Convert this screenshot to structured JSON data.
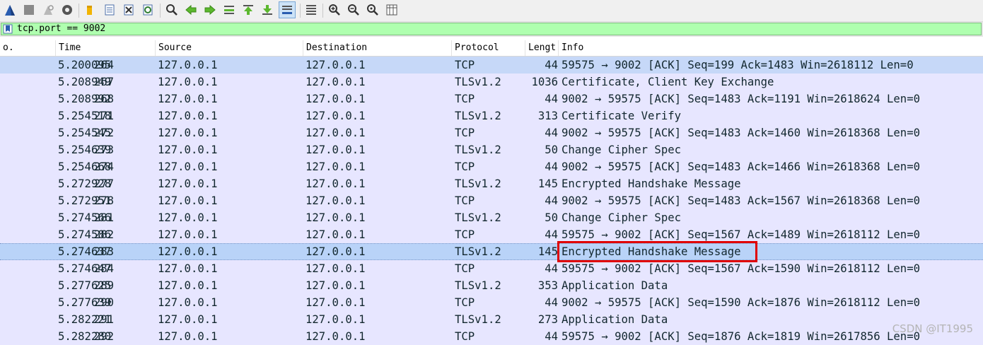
{
  "filter": {
    "text": "tcp.port == 9002"
  },
  "columns": [
    "o.",
    "Time",
    "Source",
    "Destination",
    "Protocol",
    "Lengt",
    "Info"
  ],
  "colors": {
    "tcp_row": "#e7e6ff",
    "selected_row": "#b9d3f8",
    "filter_bg": "#afffaf",
    "highlight_border": "#e00000"
  },
  "packets": [
    {
      "no": "264",
      "time": "5.200095",
      "src": "127.0.0.1",
      "dst": "127.0.0.1",
      "proto": "TCP",
      "len": "44",
      "info": "59575 → 9002 [ACK] Seq=199 Ack=1483 Win=2618112 Len=0"
    },
    {
      "no": "267",
      "time": "5.208949",
      "src": "127.0.0.1",
      "dst": "127.0.0.1",
      "proto": "TLSv1.2",
      "len": "1036",
      "info": "Certificate, Client Key Exchange"
    },
    {
      "no": "268",
      "time": "5.208992",
      "src": "127.0.0.1",
      "dst": "127.0.0.1",
      "proto": "TCP",
      "len": "44",
      "info": "9002 → 59575 [ACK] Seq=1483 Ack=1191 Win=2618624 Len=0"
    },
    {
      "no": "271",
      "time": "5.254518",
      "src": "127.0.0.1",
      "dst": "127.0.0.1",
      "proto": "TLSv1.2",
      "len": "313",
      "info": "Certificate Verify"
    },
    {
      "no": "272",
      "time": "5.254545",
      "src": "127.0.0.1",
      "dst": "127.0.0.1",
      "proto": "TCP",
      "len": "44",
      "info": "9002 → 59575 [ACK] Seq=1483 Ack=1460 Win=2618368 Len=0"
    },
    {
      "no": "273",
      "time": "5.254639",
      "src": "127.0.0.1",
      "dst": "127.0.0.1",
      "proto": "TLSv1.2",
      "len": "50",
      "info": "Change Cipher Spec"
    },
    {
      "no": "274",
      "time": "5.254668",
      "src": "127.0.0.1",
      "dst": "127.0.0.1",
      "proto": "TCP",
      "len": "44",
      "info": "9002 → 59575 [ACK] Seq=1483 Ack=1466 Win=2618368 Len=0"
    },
    {
      "no": "277",
      "time": "5.272928",
      "src": "127.0.0.1",
      "dst": "127.0.0.1",
      "proto": "TLSv1.2",
      "len": "145",
      "info": "Encrypted Handshake Message"
    },
    {
      "no": "278",
      "time": "5.272951",
      "src": "127.0.0.1",
      "dst": "127.0.0.1",
      "proto": "TCP",
      "len": "44",
      "info": "9002 → 59575 [ACK] Seq=1483 Ack=1567 Win=2618368 Len=0"
    },
    {
      "no": "281",
      "time": "5.274566",
      "src": "127.0.0.1",
      "dst": "127.0.0.1",
      "proto": "TLSv1.2",
      "len": "50",
      "info": "Change Cipher Spec"
    },
    {
      "no": "282",
      "time": "5.274586",
      "src": "127.0.0.1",
      "dst": "127.0.0.1",
      "proto": "TCP",
      "len": "44",
      "info": "59575 → 9002 [ACK] Seq=1567 Ack=1489 Win=2618112 Len=0"
    },
    {
      "no": "283",
      "time": "5.274637",
      "src": "127.0.0.1",
      "dst": "127.0.0.1",
      "proto": "TLSv1.2",
      "len": "145",
      "info": "Encrypted Handshake Message",
      "selected": true
    },
    {
      "no": "284",
      "time": "5.274647",
      "src": "127.0.0.1",
      "dst": "127.0.0.1",
      "proto": "TCP",
      "len": "44",
      "info": "59575 → 9002 [ACK] Seq=1567 Ack=1590 Win=2618112 Len=0"
    },
    {
      "no": "289",
      "time": "5.277625",
      "src": "127.0.0.1",
      "dst": "127.0.0.1",
      "proto": "TLSv1.2",
      "len": "353",
      "info": "Application Data"
    },
    {
      "no": "290",
      "time": "5.277639",
      "src": "127.0.0.1",
      "dst": "127.0.0.1",
      "proto": "TCP",
      "len": "44",
      "info": "9002 → 59575 [ACK] Seq=1590 Ack=1876 Win=2618112 Len=0"
    },
    {
      "no": "291",
      "time": "5.282221",
      "src": "127.0.0.1",
      "dst": "127.0.0.1",
      "proto": "TLSv1.2",
      "len": "273",
      "info": "Application Data"
    },
    {
      "no": "292",
      "time": "5.282280",
      "src": "127.0.0.1",
      "dst": "127.0.0.1",
      "proto": "TCP",
      "len": "44",
      "info": "59575 → 9002 [ACK] Seq=1876 Ack=1819 Win=2617856 Len=0"
    }
  ],
  "toolbar_icons": [
    "shark-fin-start-icon",
    "stop-icon",
    "restart-icon",
    "gear-icon",
    "folder-open-icon",
    "save-file-icon",
    "close-file-icon",
    "reload-icon",
    "search-icon",
    "arrow-left-icon",
    "arrow-right-icon",
    "go-to-packet-icon",
    "first-packet-icon",
    "last-packet-icon",
    "autoscroll-icon",
    "colorize-icon",
    "zoom-in-icon",
    "zoom-out-icon",
    "zoom-reset-icon",
    "resize-columns-icon"
  ],
  "watermark": "CSDN @IT1995"
}
